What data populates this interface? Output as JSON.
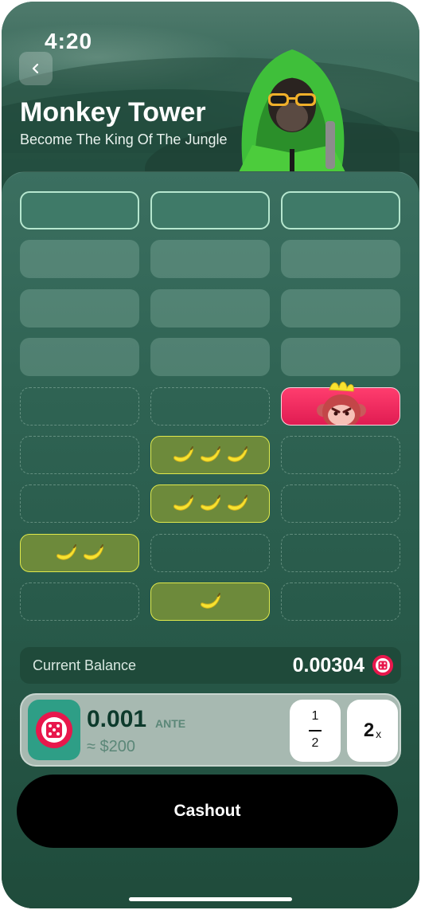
{
  "status_bar": {
    "time": "4:20"
  },
  "header": {
    "title": "Monkey Tower",
    "subtitle": "Become The King Of The Jungle",
    "back_icon": "chevron-left-icon"
  },
  "grid": {
    "columns": 3,
    "rows": [
      [
        "active",
        "active",
        "active"
      ],
      [
        "filled",
        "filled",
        "filled"
      ],
      [
        "filled",
        "filled",
        "filled"
      ],
      [
        "filled",
        "filled",
        "filled"
      ],
      [
        "empty",
        "empty",
        "monkey-bomb"
      ],
      [
        "empty",
        "bananas-3",
        "empty"
      ],
      [
        "empty",
        "bananas-3",
        "empty"
      ],
      [
        "bananas-2",
        "empty",
        "empty"
      ],
      [
        "empty",
        "bananas-1",
        "empty"
      ]
    ]
  },
  "balance": {
    "label": "Current Balance",
    "value": "0.00304",
    "coin_icon": "dice-coin-icon"
  },
  "bet": {
    "amount": "0.001",
    "currency_label": "ANTE",
    "usd": "≈ $200",
    "half_top": "1",
    "half_bottom": "2",
    "double_value": "2",
    "double_suffix": "x"
  },
  "actions": {
    "cashout_label": "Cashout"
  },
  "colors": {
    "accent_pink": "#e8174c",
    "banana_yellow": "#f7e330",
    "teal": "#2e9e86"
  }
}
